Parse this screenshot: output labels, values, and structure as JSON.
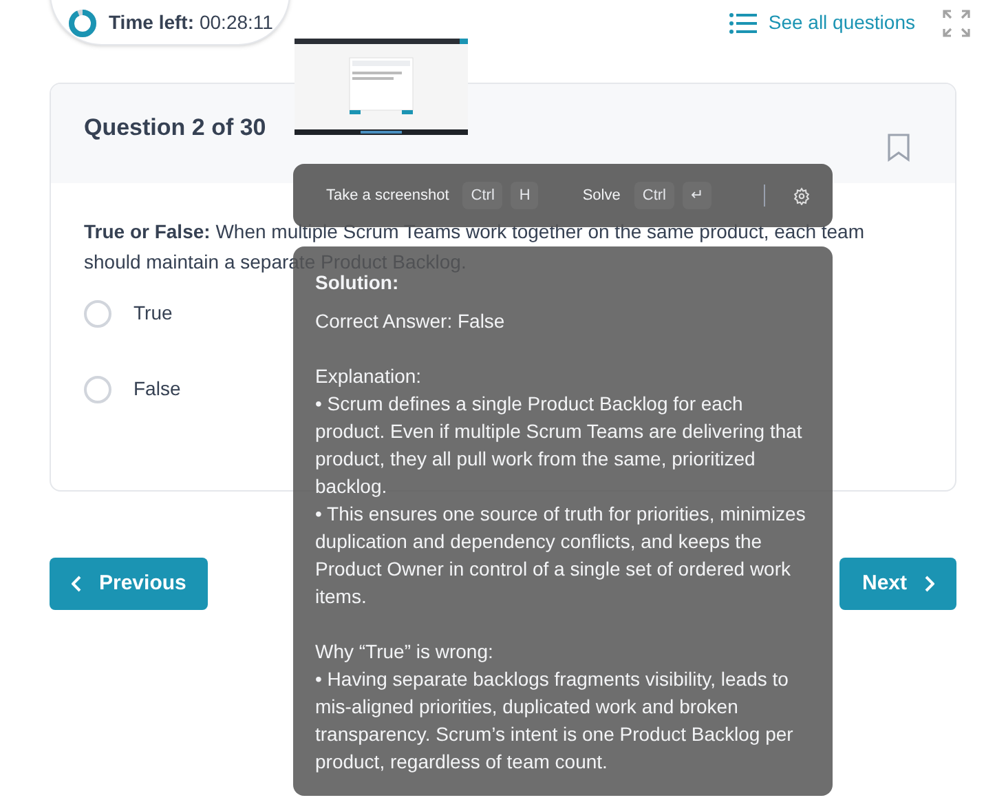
{
  "timer": {
    "label": "Time left:",
    "value": "00:28:11",
    "level": 0.93
  },
  "see_all": "See all questions",
  "question": {
    "title": "Question 2 of 30",
    "bookmarked": false,
    "text": "**True or False:** When multiple Scrum Teams work together on the same product, each team should maintain a separate Product Backlog.",
    "options": [
      {
        "label": "True",
        "selected": false
      },
      {
        "label": "False",
        "selected": false
      }
    ]
  },
  "nav": {
    "previous": "Previous",
    "next": "Next"
  },
  "toolbar": {
    "items": [
      {
        "label": "Take a screenshot",
        "keys": [
          "Ctrl",
          "H"
        ]
      },
      {
        "label": "Solve",
        "keys": [
          "Ctrl",
          "↵"
        ]
      }
    ]
  },
  "solution": {
    "title": "Solution:",
    "answer": "Correct Answer: False",
    "sections": [
      {
        "heading": "Explanation:",
        "bullets": [
          "• Scrum defines a single Product Backlog for each product. Even if multiple Scrum Teams are delivering that product, they all pull work from the same, prioritized backlog.",
          "• This ensures one source of truth for priorities, minimizes duplication and dependency conflicts, and keeps the Product Owner in control of a single set of ordered work items."
        ]
      },
      {
        "heading": "Why “True” is wrong:",
        "bullets": [
          "• Having separate backlogs fragments visibility, leads to mis-aligned priorities, duplicated work and broken transparency. Scrum’s intent is one Product Backlog per product, regardless of team count."
        ]
      }
    ]
  }
}
